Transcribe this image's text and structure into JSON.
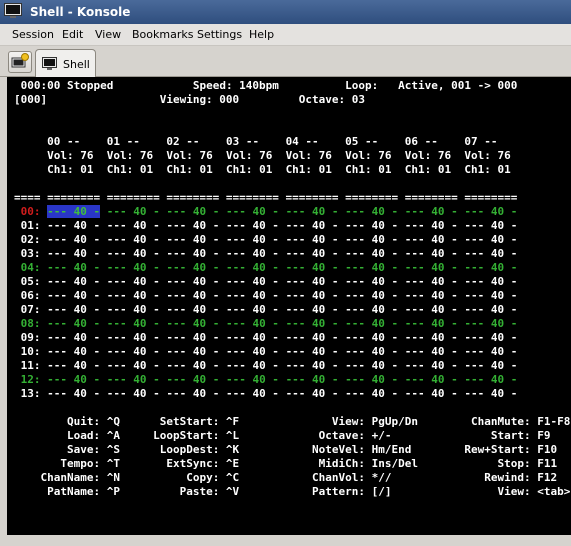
{
  "window": {
    "title": "Shell - Konsole"
  },
  "menu": [
    "Session",
    "Edit",
    "View",
    "Bookmarks",
    "Settings",
    "Help"
  ],
  "tabs": [
    {
      "label": "Shell"
    }
  ],
  "terminal": {
    "status": {
      "position": "000:00",
      "state": "Stopped",
      "speed_label": "Speed:",
      "speed": "140bpm",
      "loop_label": "Loop:",
      "loop": "Active, 001 -> 000",
      "pattern": "[000]",
      "viewing_label": "Viewing:",
      "viewing": "000",
      "octave_label": "Octave:",
      "octave": "03"
    },
    "channels": [
      {
        "header": "00 --",
        "vol": "Vol: 76",
        "ch": "Ch1: 01"
      },
      {
        "header": "01 --",
        "vol": "Vol: 76",
        "ch": "Ch1: 01"
      },
      {
        "header": "02 --",
        "vol": "Vol: 76",
        "ch": "Ch1: 01"
      },
      {
        "header": "03 --",
        "vol": "Vol: 76",
        "ch": "Ch1: 01"
      },
      {
        "header": "04 --",
        "vol": "Vol: 76",
        "ch": "Ch1: 01"
      },
      {
        "header": "05 --",
        "vol": "Vol: 76",
        "ch": "Ch1: 01"
      },
      {
        "header": "06 --",
        "vol": "Vol: 76",
        "ch": "Ch1: 01"
      },
      {
        "header": "07 --",
        "vol": "Vol: 76",
        "ch": "Ch1: 01"
      }
    ],
    "separator": "==== ======== ======== ======== ======== ======== ======== ======== ========",
    "cell": "--- 40 -",
    "rows": [
      "00:",
      "01:",
      "02:",
      "03:",
      "04:",
      "05:",
      "06:",
      "07:",
      "08:",
      "09:",
      "10:",
      "11:",
      "12:",
      "13:"
    ],
    "highlight_rows": [
      0,
      4,
      8,
      12
    ],
    "current_row": 0,
    "selected_channel": 0,
    "help": [
      [
        "Quit: ^Q",
        "SetStart: ^F",
        "View: PgUp/Dn",
        "ChanMute: F1-F8"
      ],
      [
        "Load: ^A",
        "LoopStart: ^L",
        "Octave: +/-",
        "Start: F9"
      ],
      [
        "Save: ^S",
        "LoopDest: ^K",
        "NoteVel: Hm/End",
        "Rew+Start: F10"
      ],
      [
        "Tempo: ^T",
        "ExtSync: ^E",
        "MidiCh: Ins/Del",
        "Stop: F11"
      ],
      [
        "ChanName: ^N",
        "Copy: ^C",
        "ChanVol: *//",
        "Rewind: F12"
      ],
      [
        "PatName: ^P",
        "Paste: ^V",
        "Pattern: [/]",
        "View: <tab>"
      ]
    ]
  }
}
